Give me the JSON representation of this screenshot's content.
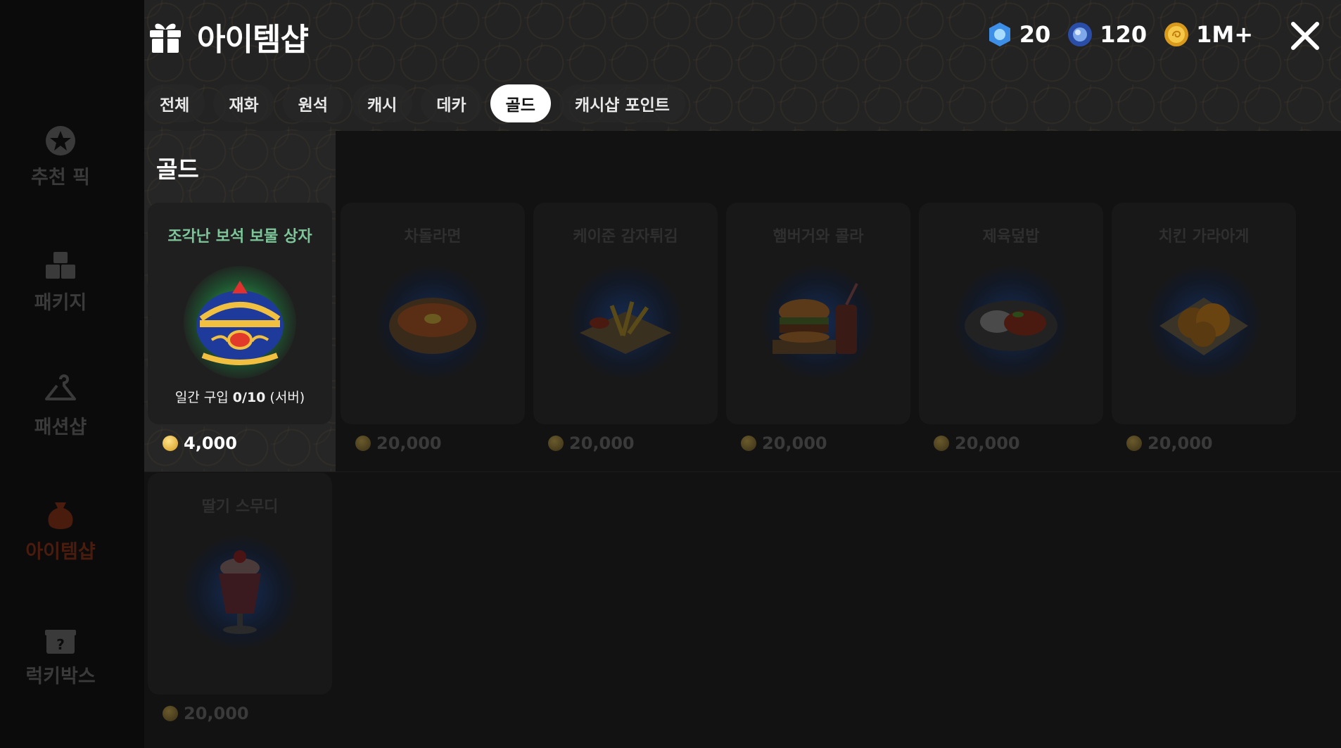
{
  "sidebar": {
    "items": [
      {
        "label": "추천 픽",
        "icon": "star-badge-icon",
        "active": false
      },
      {
        "label": "패키지",
        "icon": "package-icon",
        "active": false
      },
      {
        "label": "패션샵",
        "icon": "hanger-icon",
        "active": false
      },
      {
        "label": "아이템샵",
        "icon": "pouch-icon",
        "active": true
      },
      {
        "label": "럭키박스",
        "icon": "mystery-box-icon",
        "active": false
      }
    ]
  },
  "header": {
    "title": "아이템샵",
    "title_icon": "gift-icon",
    "currencies": [
      {
        "icon": "blue-gem-icon",
        "amount": "20"
      },
      {
        "icon": "blue-orb-icon",
        "amount": "120"
      },
      {
        "icon": "gold-coin-icon",
        "amount": "1M+"
      }
    ],
    "close_icon": "close-icon"
  },
  "tabs": [
    {
      "label": "전체",
      "active": false
    },
    {
      "label": "재화",
      "active": false
    },
    {
      "label": "원석",
      "active": false
    },
    {
      "label": "캐시",
      "active": false
    },
    {
      "label": "데카",
      "active": false
    },
    {
      "label": "골드",
      "active": true
    },
    {
      "label": "캐시샵 포인트",
      "active": false
    }
  ],
  "section": {
    "title": "골드"
  },
  "items": [
    {
      "name": "조각난 보석 보물 상자",
      "image": "jeweled-treasure-box",
      "limit_prefix": "일간 구입 ",
      "limit_count": "0/10",
      "limit_suffix": " (서버)",
      "price": "4,000",
      "active": true
    },
    {
      "name": "차돌라면",
      "image": "ramen-pot",
      "price": "20,000",
      "active": false
    },
    {
      "name": "케이준 감자튀김",
      "image": "cajun-fries",
      "price": "20,000",
      "active": false
    },
    {
      "name": "햄버거와 콜라",
      "image": "burger-and-cola",
      "price": "20,000",
      "active": false
    },
    {
      "name": "제육덮밥",
      "image": "spicy-pork-rice",
      "price": "20,000",
      "active": false
    },
    {
      "name": "치킨 가라아게",
      "image": "chicken-karaage",
      "price": "20,000",
      "active": false
    },
    {
      "name": "딸기 스무디",
      "image": "strawberry-smoothie",
      "price": "20,000",
      "active": false
    }
  ],
  "colors": {
    "accent_green": "#7cc69a",
    "sidebar_active": "#4a1c0e",
    "coin_gold": "#d49a1c"
  }
}
